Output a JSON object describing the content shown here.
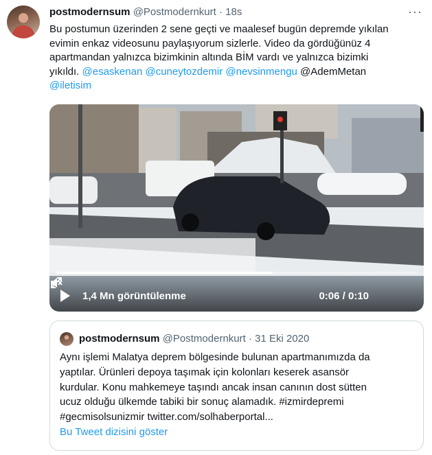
{
  "tweet": {
    "author_name": "postmodernsum",
    "handle": "@Postmodernkurt",
    "separator": "·",
    "time": "18s",
    "text_lines": [
      "Bu postumun üzerinden 2 sene geçti ve maalesef bugün depremde yıkılan",
      "evimin enkaz videosunu paylaşıyorum sizlerle. Video da gördüğünüz 4",
      "apartmandan yalnızca bizimkinin altında BİM vardı ve yalnızca bizimki",
      "yıkıldı. "
    ],
    "mentions": [
      "@esaskenan",
      "@cuneytozdemir",
      "@nevsinmengu"
    ],
    "plain_mention": "@AdemMetan",
    "last_mention": "@iletisim",
    "more_label": "···"
  },
  "video": {
    "views": "1,4 Mn görüntülenme",
    "time_readout": "0:06 / 0:10",
    "progress_fraction": 0.6
  },
  "quote": {
    "author_name": "postmodernsum",
    "handle": "@Postmodernkurt",
    "separator": "·",
    "date": "31 Eki 2020",
    "text_lines": [
      "Aynı işlemi Malatya deprem bölgesinde bulunan apartmanımızda da",
      "yaptılar. Ürünleri depoya taşımak için kolonları keserek asansör",
      "kurdular. Konu mahkemeye taşındı ancak insan canının dost sütten",
      "ucuz olduğu ülkemde tabiki bir sonuç alamadık. #izmirdepremi",
      "#gecmisolsunizmir twitter.com/solhaberportal..."
    ],
    "thread_link": "Bu Tweet dizisini göster"
  },
  "colors": {
    "link": "#1d9bf0",
    "muted": "#536471",
    "text": "#0f1419"
  }
}
